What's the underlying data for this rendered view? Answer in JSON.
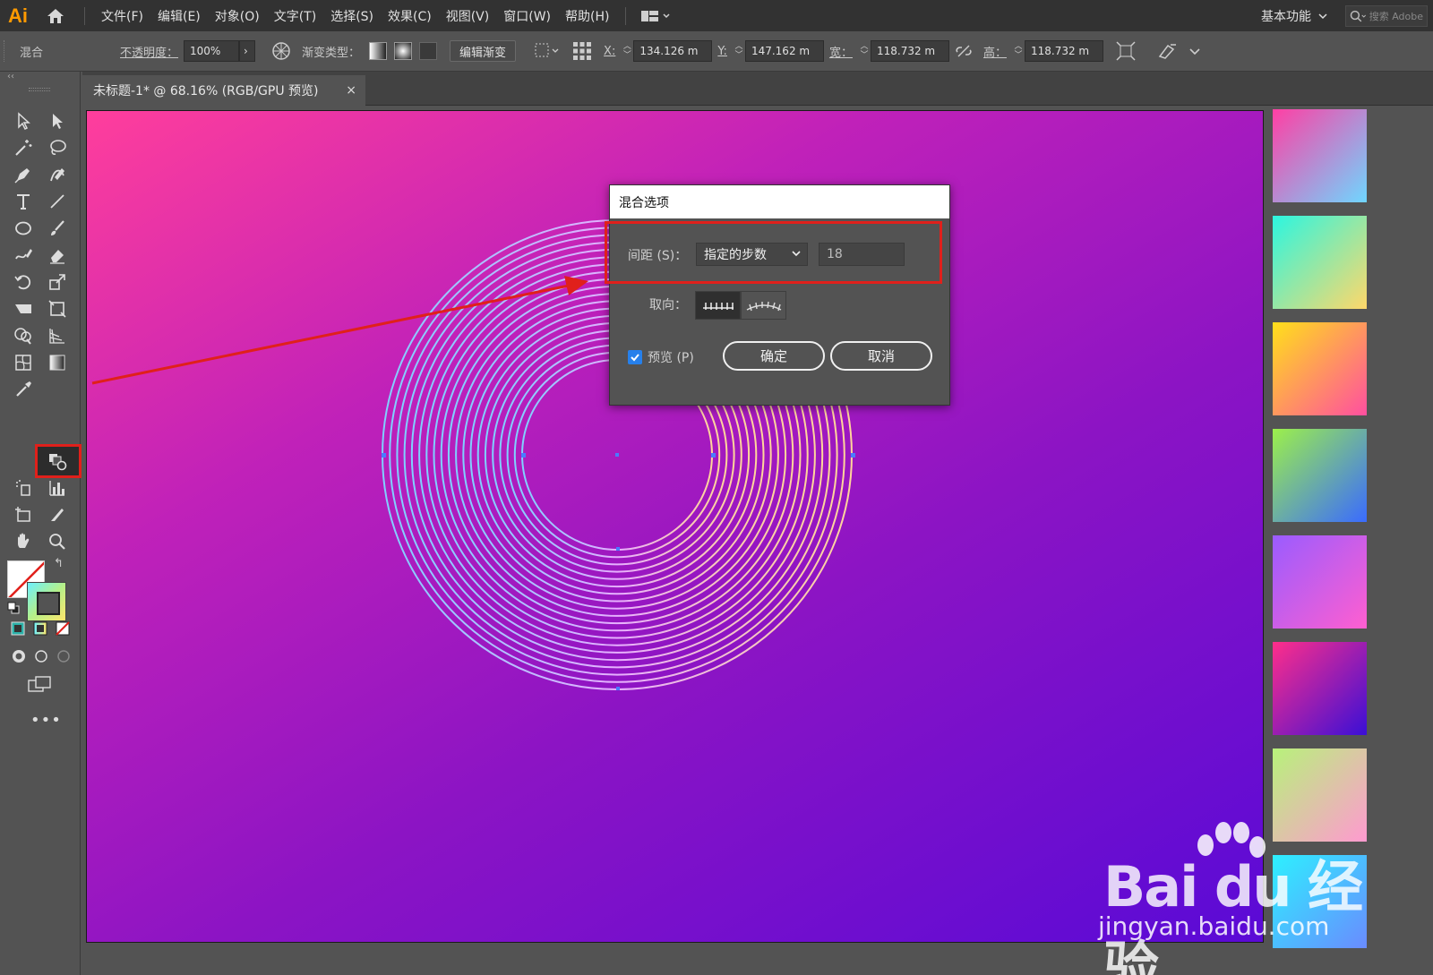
{
  "app": {
    "logo": "Ai"
  },
  "menu": [
    "文件(F)",
    "编辑(E)",
    "对象(O)",
    "文字(T)",
    "选择(S)",
    "效果(C)",
    "视图(V)",
    "窗口(W)",
    "帮助(H)"
  ],
  "workspace": {
    "label": "基本功能",
    "search_placeholder": "搜索 Adobe"
  },
  "control_bar": {
    "object_type": "混合",
    "opacity_label": "不透明度：",
    "opacity_value": "100%",
    "gradient_type_label": "渐变类型：",
    "edit_gradient_button": "编辑渐变",
    "x_label": "X:",
    "x_value": "134.126 m",
    "y_label": "Y:",
    "y_value": "147.162 m",
    "width_label": "宽：",
    "width_value": "118.732 m",
    "height_label": "高：",
    "height_value": "118.732 m"
  },
  "document_tab": {
    "title": "未标题-1* @ 68.16% (RGB/GPU 预览)",
    "close": "×"
  },
  "dialog": {
    "title": "混合选项",
    "spacing_label": "间距 (S)：",
    "spacing_option": "指定的步数",
    "steps_value": "18",
    "orientation_label": "取向：",
    "preview_label": "预览 (P)",
    "preview_checked": true,
    "ok_button": "确定",
    "cancel_button": "取消"
  },
  "gradient_swatches": [
    {
      "from": "#ff3fa4",
      "to": "#6fd6ff"
    },
    {
      "from": "#2cf6e0",
      "to": "#ffd86a"
    },
    {
      "from": "#ffe01a",
      "to": "#ff4fa0"
    },
    {
      "from": "#9cf04a",
      "to": "#3a6bff"
    },
    {
      "from": "#9a5cff",
      "to": "#ff5fd0"
    },
    {
      "from": "#ff2e8a",
      "to": "#3a0fd6"
    },
    {
      "from": "#b7f27a",
      "to": "#ff9ad0"
    },
    {
      "from": "#2df0ff",
      "to": "#6a8bff"
    }
  ],
  "colors": {
    "canvas_gradient": [
      "#ff3e9c",
      "#c021b9",
      "#8c14c4",
      "#5a0ad6"
    ],
    "highlight": "#e0201b",
    "ring_outer": "#6fb4ff",
    "ring_inner": "#ffd2a0"
  },
  "watermark": {
    "brand": "Bai du 经验",
    "site": "jingyan.baidu.com"
  }
}
